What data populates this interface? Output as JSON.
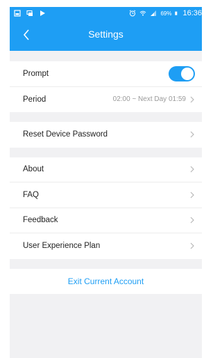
{
  "statusbar": {
    "battery_percent": "69%",
    "time": "16:36"
  },
  "header": {
    "title": "Settings"
  },
  "groups": {
    "notifications": {
      "prompt_label": "Prompt",
      "prompt_enabled": true,
      "period_label": "Period",
      "period_value": "02:00 ~ Next Day 01:59"
    },
    "device": {
      "reset_password_label": "Reset Device Password"
    },
    "info": {
      "about_label": "About",
      "faq_label": "FAQ",
      "feedback_label": "Feedback",
      "uep_label": "User Experience Plan"
    }
  },
  "exit": {
    "label": "Exit Current Account"
  },
  "colors": {
    "accent": "#1e9ef4",
    "background": "#f1f1f3"
  }
}
